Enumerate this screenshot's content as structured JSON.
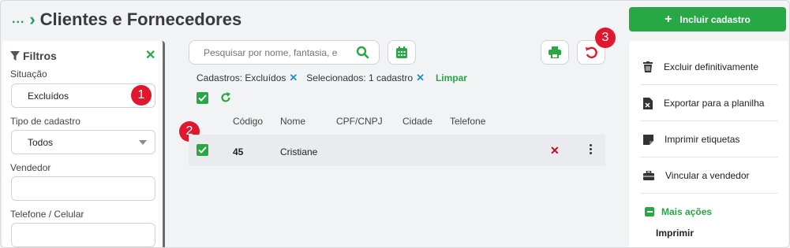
{
  "header": {
    "breadcrumb": "...",
    "title": "Clientes e Fornecedores",
    "primary_button": "Incluir cadastro"
  },
  "filters": {
    "title": "Filtros",
    "situacao": {
      "label": "Situação",
      "value": "Excluídos"
    },
    "tipo": {
      "label": "Tipo de cadastro",
      "value": "Todos"
    },
    "vendedor": {
      "label": "Vendedor",
      "value": ""
    },
    "telefone": {
      "label": "Telefone / Celular",
      "value": ""
    }
  },
  "search": {
    "placeholder": "Pesquisar por nome, fantasia, e"
  },
  "active_filters": {
    "cadastros": "Cadastros: Excluídos",
    "selecionados": "Selecionados: 1 cadastro",
    "clear": "Limpar"
  },
  "table": {
    "columns": [
      "Código",
      "Nome",
      "CPF/CNPJ",
      "Cidade",
      "Telefone"
    ],
    "rows": [
      {
        "codigo": "45",
        "nome": "Cristiane",
        "cpf": "",
        "cidade": "",
        "telefone": "",
        "selected": true
      }
    ]
  },
  "actions": {
    "items": [
      {
        "label": "Excluir definitivamente",
        "icon": "trash-icon"
      },
      {
        "label": "Exportar para a planilha",
        "icon": "excel-file-icon"
      },
      {
        "label": "Imprimir etiquetas",
        "icon": "label-icon"
      },
      {
        "label": "Vincular a vendedor",
        "icon": "briefcase-icon"
      }
    ],
    "more_label": "Mais ações",
    "print_label": "Imprimir"
  },
  "badges": [
    "1",
    "2",
    "3"
  ],
  "colors": {
    "accent": "#28a745",
    "badge": "#e0182d",
    "delete": "#d0021b",
    "link": "#1e90c8"
  }
}
